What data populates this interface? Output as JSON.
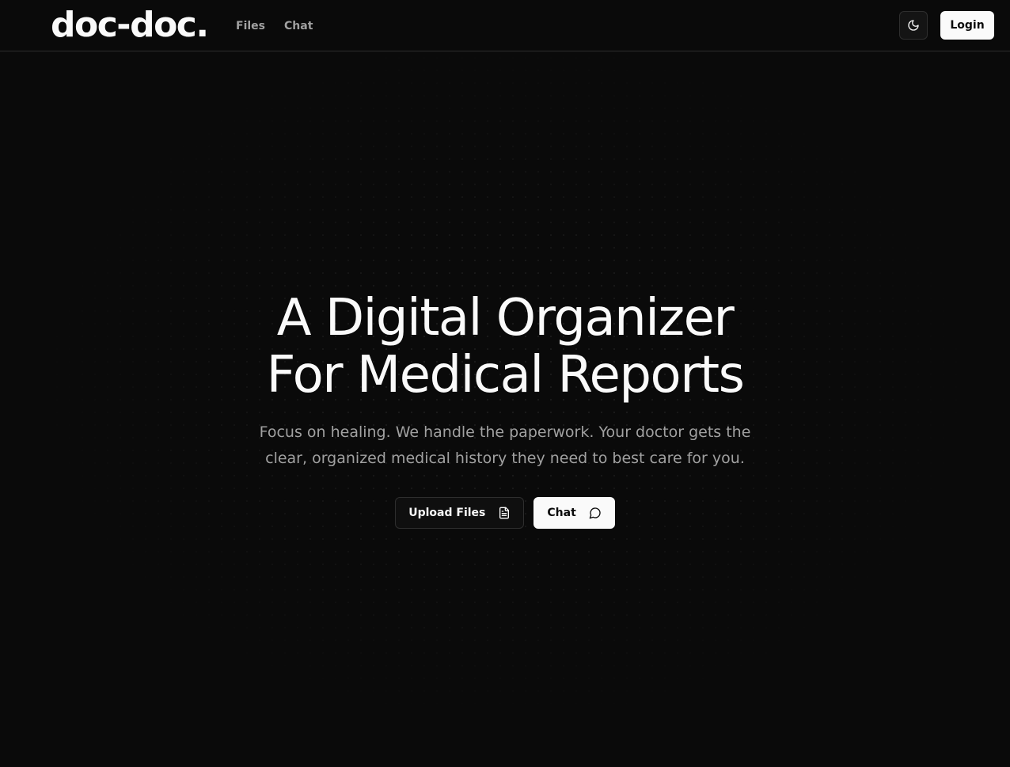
{
  "header": {
    "logo": "doc-doc.",
    "nav": [
      {
        "label": "Files"
      },
      {
        "label": "Chat"
      }
    ],
    "theme_toggle_icon": "moon-icon",
    "login_label": "Login"
  },
  "hero": {
    "title_line1": "A Digital Organizer",
    "title_line2": "For Medical Reports",
    "subtitle": "Focus on healing. We handle the paperwork. Your doctor gets the clear, organized medical history they need to best care for you.",
    "upload_label": "Upload Files",
    "upload_icon": "file-text-icon",
    "chat_label": "Chat",
    "chat_icon": "message-circle-icon"
  },
  "colors": {
    "background": "#0a0a0a",
    "foreground": "#fafafa",
    "muted": "#a1a1a1",
    "border": "#2e2e2e"
  }
}
